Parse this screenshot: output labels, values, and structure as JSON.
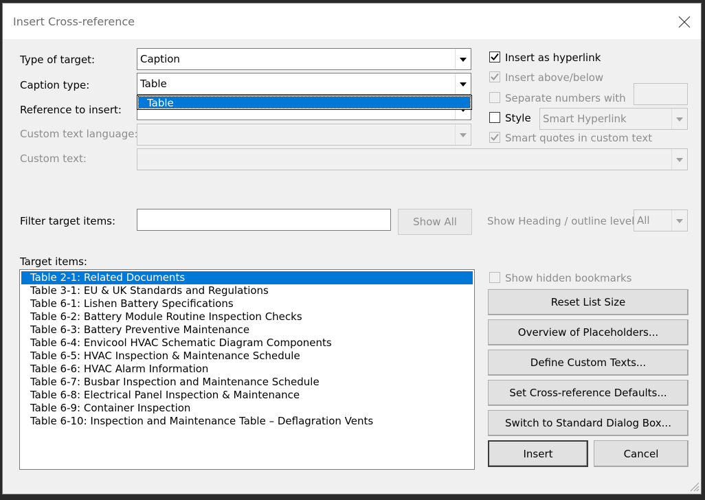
{
  "window": {
    "title": "Insert Cross-reference"
  },
  "type_of_target": {
    "label": "Type of target:",
    "value": "Caption"
  },
  "caption_type": {
    "label": "Caption type:",
    "value": "Table",
    "dropdown_options": [
      "Table"
    ]
  },
  "reference_to_insert": {
    "label": "Reference to insert:"
  },
  "custom_text_language": {
    "label": "Custom text language:"
  },
  "custom_text": {
    "label": "Custom text:"
  },
  "options": {
    "insert_as_hyperlink": {
      "label": "Insert as hyperlink",
      "checked": true
    },
    "insert_above_below": {
      "label": "Insert above/below",
      "checked": true
    },
    "separate_numbers_with": {
      "label": "Separate numbers with",
      "checked": false
    },
    "style": {
      "label": "Style",
      "checked": false,
      "value": "Smart Hyperlink"
    },
    "smart_quotes": {
      "label": "Smart quotes in custom text",
      "checked": true
    }
  },
  "filter": {
    "label": "Filter target items:",
    "value": "",
    "show_all_label": "Show All",
    "heading_level_label": "Show Heading / outline level:",
    "heading_level_value": "All"
  },
  "target_items": {
    "label": "Target items:",
    "items": [
      "Table 2-1: Related Documents",
      "Table 3-1: EU & UK Standards and Regulations",
      "Table 6-1: Lishen Battery Specifications",
      "Table 6-2: Battery Module Routine Inspection Checks",
      "Table 6-3: Battery Preventive Maintenance",
      "Table 6-4: Envicool HVAC Schematic Diagram Components",
      "Table 6-5: HVAC Inspection & Maintenance Schedule",
      "Table 6-6: HVAC Alarm Information",
      "Table 6-7: Busbar Inspection and Maintenance Schedule",
      "Table 6-8: Electrical Panel Inspection & Maintenance",
      "Table 6-9: Container Inspection",
      "Table 6-10: Inspection and Maintenance Table – Deflagration Vents"
    ],
    "selected_index": 0
  },
  "show_hidden_bookmarks": {
    "label": "Show hidden bookmarks",
    "checked": false
  },
  "buttons": {
    "reset_list_size": "Reset List Size",
    "overview_placeholders": "Overview of Placeholders...",
    "define_custom_texts": "Define Custom Texts...",
    "set_defaults": "Set Cross-reference Defaults...",
    "switch_standard": "Switch to Standard Dialog Box...",
    "insert": "Insert",
    "cancel": "Cancel"
  },
  "colors": {
    "selection": "#0078d7",
    "dialog_bg": "#f0f0f0",
    "disabled_text": "#8d8d8d"
  },
  "icons": {
    "close": "close-icon",
    "checkmark": "checkmark-icon",
    "resize": "resize-grip-icon"
  }
}
